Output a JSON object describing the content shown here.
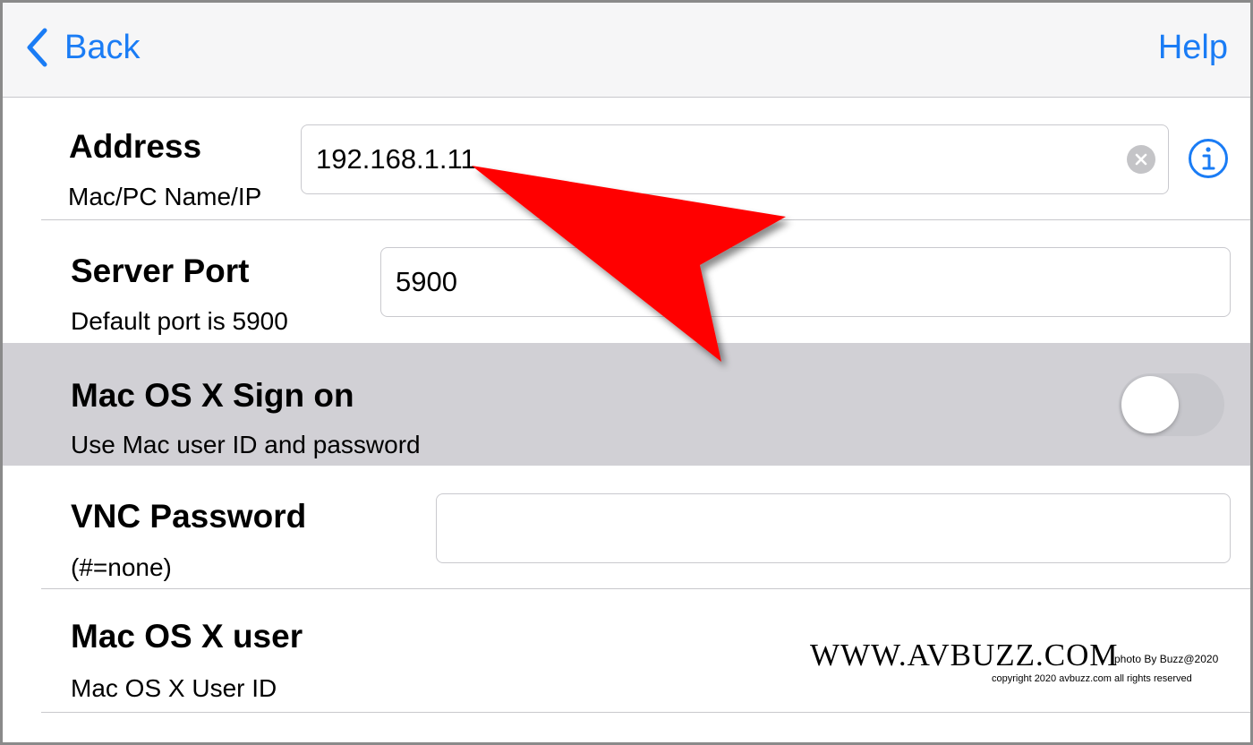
{
  "nav": {
    "back_label": "Back",
    "help_label": "Help"
  },
  "rows": {
    "address": {
      "title": "Address",
      "subtitle": "Mac/PC Name/IP",
      "value": "192.168.1.11"
    },
    "port": {
      "title": "Server Port",
      "subtitle": "Default port is 5900",
      "value": "5900"
    },
    "signon": {
      "title": "Mac OS X Sign on",
      "subtitle": "Use Mac user ID and password",
      "toggle_on": false
    },
    "vnc": {
      "title": "VNC Password",
      "subtitle": "(#=none)",
      "value": ""
    },
    "user": {
      "title": "Mac OS X user",
      "subtitle": "Mac OS X User ID"
    }
  },
  "icons": {
    "back": "chevron-left-icon",
    "clear": "clear-circle-icon",
    "info": "info-circle-icon",
    "annotation": "red-arrow-pointer"
  },
  "colors": {
    "accent": "#1a7cf5",
    "highlight_row": "#d1d0d5",
    "arrow": "#ff0000"
  },
  "watermark": {
    "site": "WWW.AVBUZZ.COM",
    "photo_credit": "photo By Buzz@2020",
    "copyright": "copyright 2020 avbuzz.com all rights reserved"
  }
}
